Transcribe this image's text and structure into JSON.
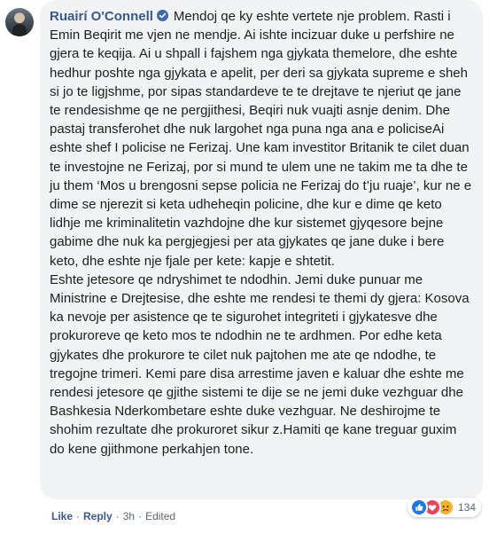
{
  "comment": {
    "author": "Ruairí O'Connell",
    "paragraph_1": "Mendoj qe ky eshte vertete nje problem. Rasti i Emin Beqirit me vjen ne mendje. Ai ishte incizuar duke u perfshire ne gjera te keqija. Ai u shpall i fajshem nga gjykata themelore, dhe eshte hedhur poshte nga gjykata e apelit, per deri sa gjykata supreme e sheh si jo te ligjshme, por sipas standardeve te te drejtave te njeriut qe jane te rendesishme qe ne pergjithesi, Beqiri nuk vuajti asnje denim. Dhe pastaj transferohet dhe nuk largohet nga puna nga ana e policiseAi eshte shef I policise ne Ferizaj. Une kam investitor Britanik te cilet duan te investojne ne Ferizaj, por si mund te ulem une ne takim me ta dhe te ju them ‘Mos u brengosni sepse policia ne Ferizaj do t’ju ruaje’, kur ne e dime se njerezit si keta udheheqin policine, dhe kur e dime qe keto lidhje me kriminalitetin vazhdojne dhe kur sistemet gjyqesore bejne gabime dhe nuk ka pergjegjesi per ata gjykates qe jane duke i bere keto, dhe eshte nje fjale per kete: kapje e shtetit.",
    "paragraph_2": "Eshte jetesore qe ndryshimet te ndodhin. Jemi duke punuar me Ministrine e Drejtesise, dhe eshte me rendesi te themi dy gjera: Kosova ka nevoje per asistence qe te sigurohet integriteti i gjykatesve dhe prokuroreve qe keto mos te ndodhin ne te ardhmen. Por edhe keta gjykates dhe prokurore te cilet nuk pajtohen me ate qe ndodhe, te tregojne trimeri. Kemi pare disa arrestime javen e kaluar dhe eshte me rendesi jetesore qe gjithe sistemi te dije se ne jemi duke vezhguar dhe Bashkesia Nderkombetare eshte duke vezhguar. Ne deshirojme te shohim rezultate dhe prokuroret sikur z.Hamiti qe kane treguar guxim do kene gjithmone perkahjen tone."
  },
  "actions": {
    "like": "Like",
    "reply": "Reply",
    "time": "3h",
    "edited": "Edited",
    "separator": "·"
  },
  "reactions": {
    "count": "134",
    "types": [
      "like",
      "love",
      "sad"
    ]
  },
  "colors": {
    "bubble_bg": "#f2f3f5",
    "link": "#385898",
    "text": "#1c1e21",
    "meta": "#606770"
  }
}
